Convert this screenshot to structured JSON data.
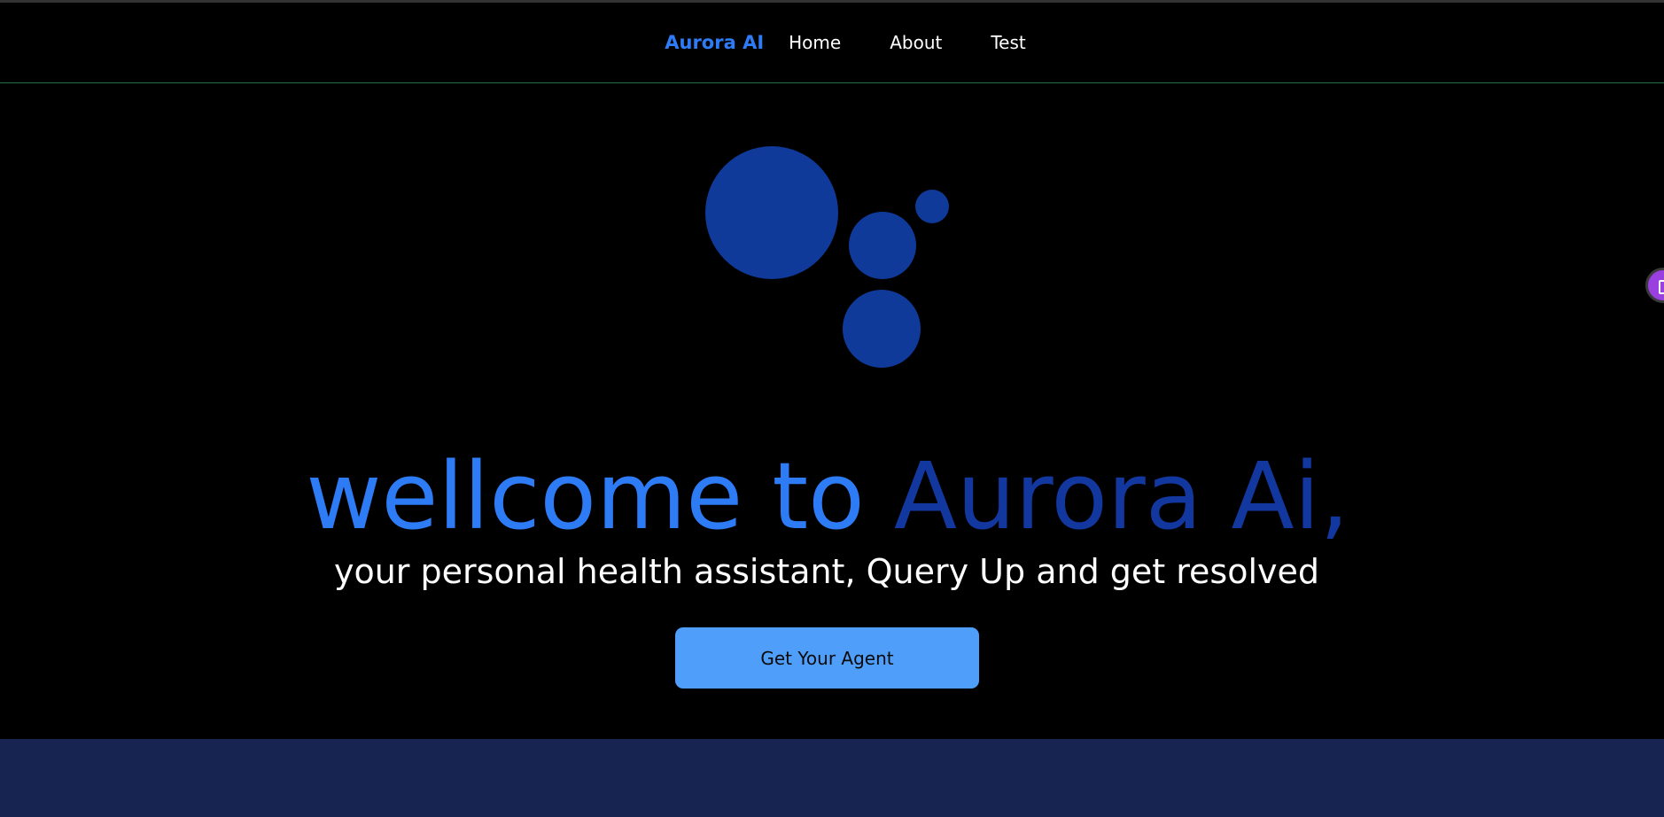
{
  "nav": {
    "brand": "Aurora AI",
    "links": [
      "Home",
      "About",
      "Test"
    ]
  },
  "hero": {
    "headline_part1": "wellcome to ",
    "headline_part2": "Aurora Ai,",
    "subheadline": "your personal health assistant, Query Up and get resolved",
    "cta_label": "Get Your Agent",
    "logo_icon": "bubbles-logo-icon"
  },
  "side_widget": {
    "icon": "assistant-widget-icon"
  },
  "colors": {
    "accent": "#2e7bf6",
    "accent_dark": "#1238a0",
    "logo_blue": "#0f3a9a",
    "cta_bg": "#4f9ffa",
    "band": "#172452",
    "widget": "#9a3fe0"
  }
}
